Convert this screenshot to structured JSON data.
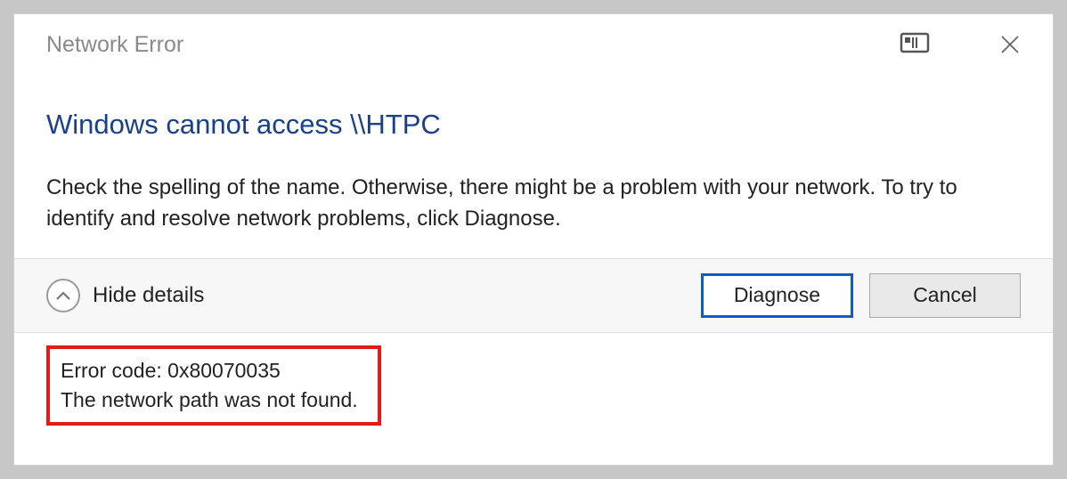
{
  "titlebar": {
    "title": "Network Error",
    "screen_icon": "monitor-icon",
    "close_icon": "close-icon"
  },
  "main": {
    "heading": "Windows cannot access \\\\HTPC",
    "body": "Check the spelling of the name. Otherwise, there might be a problem with your network. To try to identify and resolve network problems, click Diagnose."
  },
  "footer": {
    "toggle_label": "Hide details",
    "diagnose_label": "Diagnose",
    "cancel_label": "Cancel"
  },
  "details": {
    "error_code_line": "Error code: 0x80070035",
    "error_msg_line": "The network path was not found."
  }
}
